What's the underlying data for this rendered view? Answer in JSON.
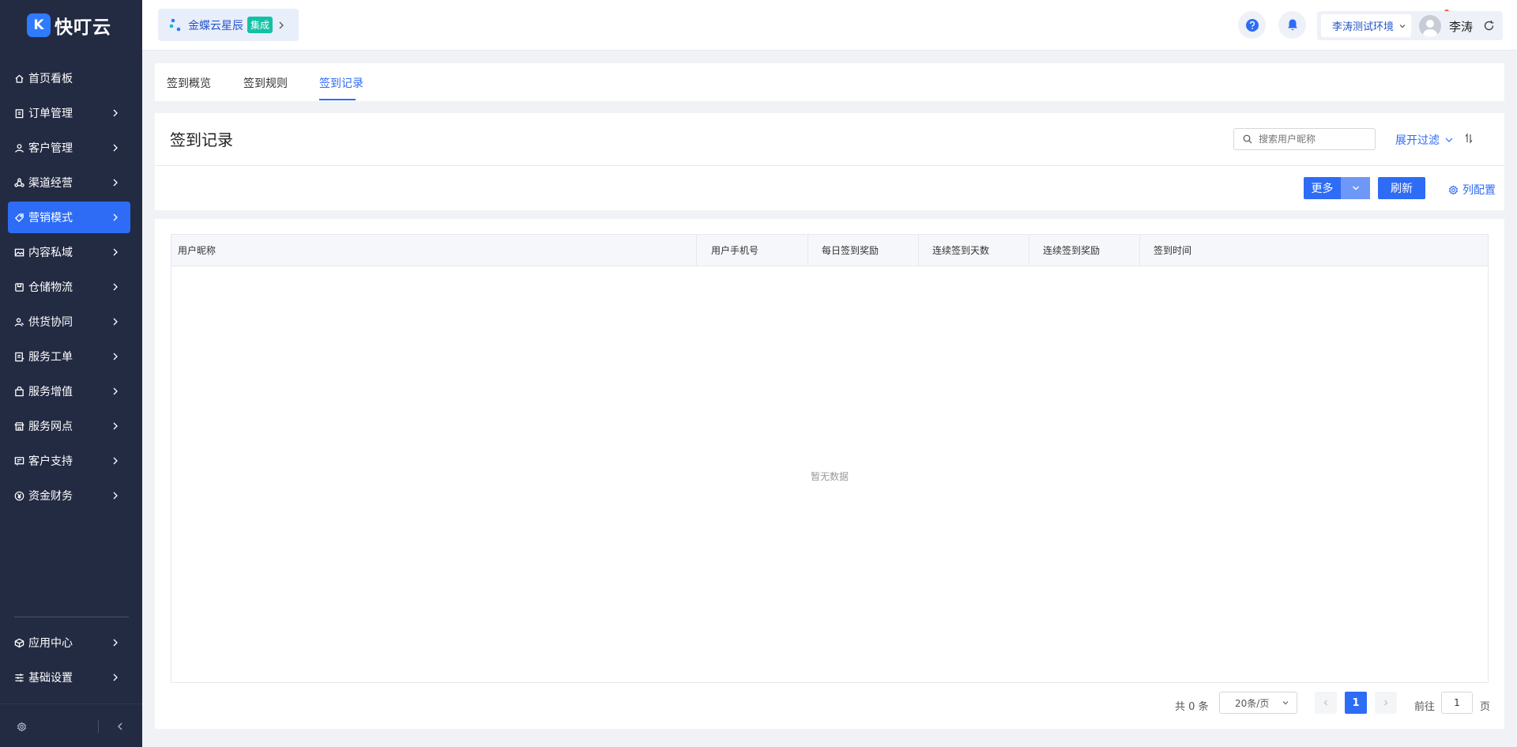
{
  "app": {
    "logo_mark": "K",
    "name": "快叮云"
  },
  "header": {
    "product_name": "金蝶云星辰",
    "product_badge": "集成",
    "environment": "李涛测试环境",
    "user_name": "李涛"
  },
  "sidebar": {
    "items": [
      {
        "label": "首页看板",
        "icon": "home-icon",
        "has_children": false,
        "active": false
      },
      {
        "label": "订单管理",
        "icon": "clipboard-icon",
        "has_children": true,
        "active": false
      },
      {
        "label": "客户管理",
        "icon": "user-icon",
        "has_children": true,
        "active": false
      },
      {
        "label": "渠道经营",
        "icon": "channel-icon",
        "has_children": true,
        "active": false
      },
      {
        "label": "营销模式",
        "icon": "tag-icon",
        "has_children": true,
        "active": true
      },
      {
        "label": "内容私域",
        "icon": "image-icon",
        "has_children": true,
        "active": false
      },
      {
        "label": "仓储物流",
        "icon": "box-icon",
        "has_children": true,
        "active": false
      },
      {
        "label": "供货协同",
        "icon": "people-icon",
        "has_children": true,
        "active": false
      },
      {
        "label": "服务工单",
        "icon": "ticket-icon",
        "has_children": true,
        "active": false
      },
      {
        "label": "服务增值",
        "icon": "bag-icon",
        "has_children": true,
        "active": false
      },
      {
        "label": "服务网点",
        "icon": "store-icon",
        "has_children": true,
        "active": false
      },
      {
        "label": "客户支持",
        "icon": "support-icon",
        "has_children": true,
        "active": false
      },
      {
        "label": "资金财务",
        "icon": "yen-icon",
        "has_children": true,
        "active": false
      }
    ],
    "bottom_items": [
      {
        "label": "应用中心",
        "icon": "cube-icon"
      },
      {
        "label": "基础设置",
        "icon": "sliders-icon"
      }
    ]
  },
  "tabs": [
    {
      "label": "签到概览",
      "active": false
    },
    {
      "label": "签到规则",
      "active": false
    },
    {
      "label": "签到记录",
      "active": true
    }
  ],
  "page": {
    "title": "签到记录",
    "search_placeholder": "搜索用户昵称",
    "expand_filter": "展开过滤",
    "more_button": "更多",
    "refresh_button": "刷新",
    "column_config": "列配置"
  },
  "table": {
    "columns": [
      "用户昵称",
      "用户手机号",
      "每日签到奖励",
      "连续签到天数",
      "连续签到奖励",
      "签到时间"
    ],
    "rows": [],
    "empty_text": "暂无数据"
  },
  "pagination": {
    "total_text": "共 0 条",
    "page_size": "20条/页",
    "current_page": "1",
    "goto_label": "前往",
    "goto_value": "1",
    "page_suffix": "页"
  },
  "colors": {
    "primary": "#2e6cf6",
    "sidebar_bg": "#232b43",
    "badge": "#13c2a5"
  }
}
